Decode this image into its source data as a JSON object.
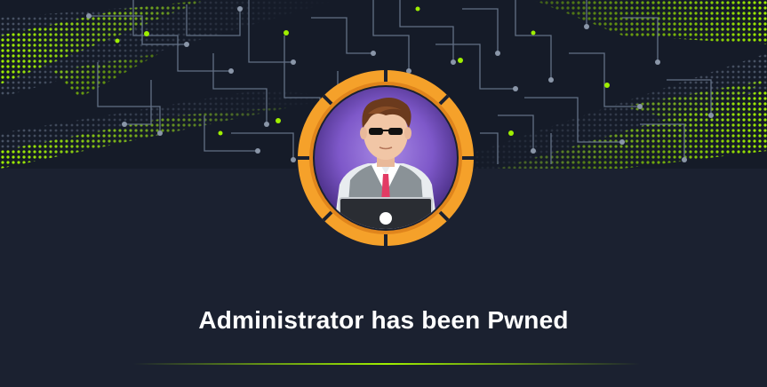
{
  "banner": {
    "accent_color": "#9fef00",
    "circuit_color": "#6b7a90",
    "background_color": "#151b28"
  },
  "avatar": {
    "icon": "hacker-avatar-icon",
    "ring_color": "#f5a12a",
    "inner_color": "#7e58c9"
  },
  "message": {
    "title": "Administrator has been Pwned"
  },
  "divider": {
    "color": "#9fef00"
  }
}
